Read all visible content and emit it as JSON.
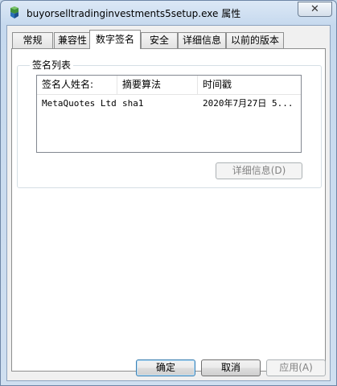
{
  "window": {
    "title": "buyorselltradinginvestments5setup.exe 属性",
    "close_glyph": "✕"
  },
  "tabs": [
    {
      "label": "常规",
      "active": false
    },
    {
      "label": "兼容性",
      "active": false
    },
    {
      "label": "数字签名",
      "active": true
    },
    {
      "label": "安全",
      "active": false
    },
    {
      "label": "详细信息",
      "active": false
    },
    {
      "label": "以前的版本",
      "active": false
    }
  ],
  "signature_list": {
    "group_label": "签名列表",
    "columns": [
      "签名人姓名:",
      "摘要算法",
      "时间戳"
    ],
    "rows": [
      {
        "signer": "MetaQuotes Ltd.",
        "digest": "sha1",
        "timestamp": "2020年7月27日 5..."
      }
    ],
    "details_button": "详细信息(D)"
  },
  "buttons": {
    "ok": "确定",
    "cancel": "取消",
    "apply": "应用(A)"
  }
}
